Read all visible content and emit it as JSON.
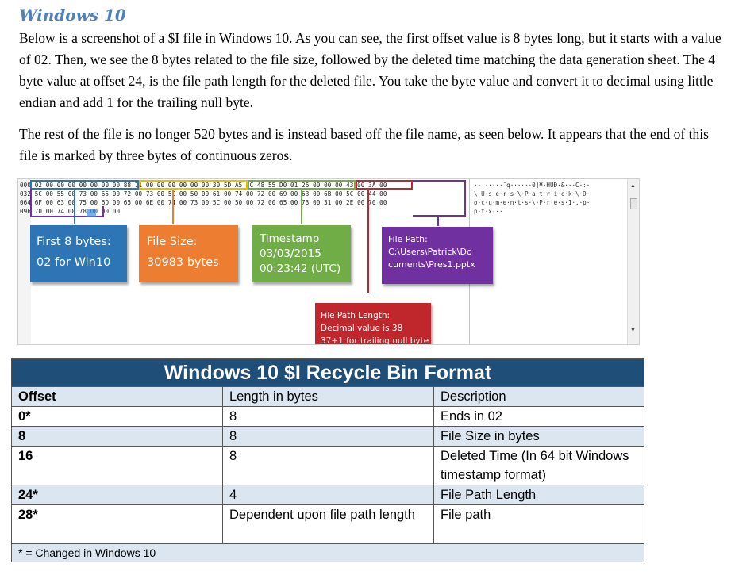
{
  "heading": "Windows 10",
  "paragraphs": [
    "Below is a screenshot of a $I file in Windows 10. As you can see, the first offset value is 8 bytes long, but it starts with a value of 02. Then, we see the 8 bytes related to the file size, followed by the deleted time matching the data generation sheet. The 4 byte value at offset 24, is the file path length for the deleted file. You take the byte value and convert it to decimal using little endian and add 1 for the trailing null byte.",
    "The rest of the file is no longer 520 bytes and is instead based off the file name, as seen below. It appears that the end of this file is marked by three bytes of continuous zeros."
  ],
  "hex_view": {
    "rows": [
      {
        "offset": "000",
        "hex": "02 00 00 00 00 00 00 00 88 71 00 00 00 00 00 00 30 5D A5 1C 48 55 D0 01 26 00 00 00 43 00 3A 00",
        "ascii": "········ˆq······0]¥·HUÐ·&···C·:·"
      },
      {
        "offset": "032",
        "hex": "5C 00 55 00 73 00 65 00 72 00 73 00 5C 00 50 00 61 00 74 00 72 00 69 00 63 00 6B 00 5C 00 44 00",
        "ascii": "\\·U·s·e·r·s·\\·P·a·t·r·i·c·k·\\·D·"
      },
      {
        "offset": "064",
        "hex": "6F 00 63 00 75 00 6D 00 65 00 6E 00 74 00 73 00 5C 00 50 00 72 00 65 00 73 00 31 00 2E 00 70 00",
        "ascii": "o·c·u·m·e·n·t·s·\\·P·r·e·s·1·.·p·"
      },
      {
        "offset": "096",
        "hex": "70 00 74 00 78 00 00 00",
        "ascii": "p·t·x···"
      }
    ]
  },
  "callouts": {
    "first": [
      "First 8 bytes:",
      "02 for Win10"
    ],
    "size": [
      "File Size:",
      "30983 bytes"
    ],
    "timestamp": [
      "Timestamp",
      "03/03/2015",
      "00:23:42 (UTC)"
    ],
    "path": [
      "File Path:",
      "C:\\Users\\Patrick\\Do",
      "cuments\\Pres1.pptx"
    ],
    "length": [
      "File Path Length:",
      "Decimal value is 38",
      "37+1 for trailing null byte"
    ]
  },
  "colors": {
    "first": "#2e75b6",
    "size": "#ed7d31",
    "timestamp": "#70ad47",
    "path": "#7030a0",
    "length": "#c0272d",
    "table_title": "#1f4e79",
    "table_shade": "#dce6f1",
    "heading": "#4f81bd"
  },
  "table": {
    "title": "Windows 10 $I Recycle Bin Format",
    "headers": [
      "Offset",
      "Length in bytes",
      "Description"
    ],
    "rows": [
      {
        "offset": "0*",
        "length": "8",
        "description": "Ends in 02"
      },
      {
        "offset": "8",
        "length": "8",
        "description": "File Size in bytes"
      },
      {
        "offset": "16",
        "length": "8",
        "description": "Deleted Time (In 64 bit Windows timestamp format)"
      },
      {
        "offset": "24*",
        "length": "4",
        "description": "File Path Length"
      },
      {
        "offset": "28*",
        "length": "Dependent upon file path length",
        "description": "File path"
      }
    ],
    "footnote": "*  =  Changed in Windows 10"
  }
}
